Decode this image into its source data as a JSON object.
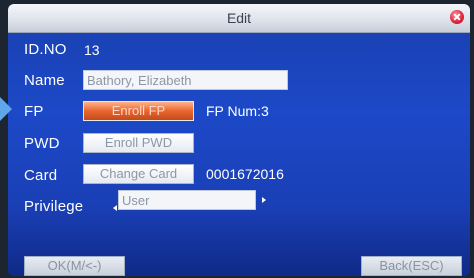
{
  "window": {
    "title": "Edit"
  },
  "form": {
    "id_label": "ID.NO",
    "id_value": "13",
    "name_label": "Name",
    "name_value": "Bathory, Elizabeth",
    "fp_label": "FP",
    "fp_button": "Enroll FP",
    "fp_num": "FP Num:3",
    "pwd_label": "PWD",
    "pwd_button": "Enroll PWD",
    "card_label": "Card",
    "card_button": "Change Card",
    "card_number": "0001672016",
    "privilege_label": "Privilege",
    "privilege_value": "User"
  },
  "footer": {
    "ok_label": "OK(M/<-)",
    "back_label": "Back(ESC)"
  },
  "colors": {
    "background": "#1c49c8",
    "titlebar": "#dfe4ec",
    "selected_button": "#e8652e",
    "close": "#e0283e"
  },
  "icons": {
    "close": "close-icon",
    "pointer": "pointer-arrow-icon",
    "privilege_prev": "left-arrow-icon",
    "privilege_next": "right-arrow-icon"
  }
}
